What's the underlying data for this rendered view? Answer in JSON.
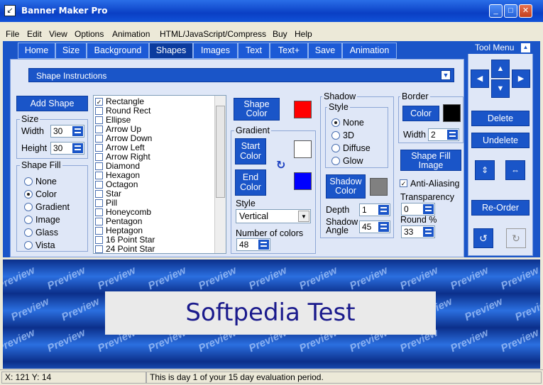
{
  "window": {
    "title": "Banner Maker Pro",
    "buttons": [
      "_",
      "□",
      "✕"
    ]
  },
  "menu": [
    "File",
    "Edit",
    "View",
    "Options",
    "Animation",
    "HTML/JavaScript/Compress",
    "Buy",
    "Help"
  ],
  "tabs": [
    "Home",
    "Size",
    "Background",
    "Shapes",
    "Images",
    "Text",
    "Text+",
    "Save",
    "Animation"
  ],
  "active_tab": "Shapes",
  "instructions": {
    "label": "Shape Instructions"
  },
  "add_shape": "Add Shape",
  "size": {
    "title": "Size",
    "width_label": "Width",
    "width": "30",
    "height_label": "Height",
    "height": "30"
  },
  "shape_fill": {
    "title": "Shape Fill",
    "options": [
      "None",
      "Color",
      "Gradient",
      "Image",
      "Glass",
      "Vista"
    ],
    "selected": "Color"
  },
  "shape_list": [
    "Rectangle",
    "Round Rect",
    "Ellipse",
    "Arrow Up",
    "Arrow Down",
    "Arrow Left",
    "Arrow Right",
    "Diamond",
    "Hexagon",
    "Octagon",
    "Star",
    "Pill",
    "Honeycomb",
    "Pentagon",
    "Heptagon",
    "16 Point Star",
    "24 Point Star"
  ],
  "shape_color": {
    "label": "Shape Color",
    "color": "#ff0000"
  },
  "gradient": {
    "title": "Gradient",
    "start_label": "Start Color",
    "start_color": "#ffffff",
    "end_label": "End Color",
    "end_color": "#0000ff",
    "style_label": "Style",
    "style_value": "Vertical",
    "num_colors_label": "Number of colors",
    "num_colors": "48"
  },
  "shadow": {
    "title": "Shadow",
    "style_title": "Style",
    "options": [
      "None",
      "3D",
      "Diffuse",
      "Glow"
    ],
    "selected": "None",
    "color_label": "Shadow Color",
    "color": "#808080",
    "depth_label": "Depth",
    "depth": "1",
    "angle_label": "Shadow Angle",
    "angle": "45"
  },
  "border": {
    "title": "Border",
    "color_label": "Color",
    "color": "#000000",
    "width_label": "Width",
    "width": "2"
  },
  "shape_fill_image": "Shape Fill Image",
  "anti_aliasing": {
    "label": "Anti-Aliasing",
    "checked": true
  },
  "transparency": {
    "label": "Transparency",
    "value": "0"
  },
  "round": {
    "label": "Round %",
    "value": "33"
  },
  "tool_menu": {
    "title": "Tool Menu",
    "delete": "Delete",
    "undelete": "Undelete",
    "reorder": "Re-Order"
  },
  "preview": {
    "banner_text": "Softpedia Test",
    "watermark": "Preview"
  },
  "status": {
    "coords": "X: 121  Y: 14",
    "message": "This is day 1 of your 15 day evaluation period."
  }
}
